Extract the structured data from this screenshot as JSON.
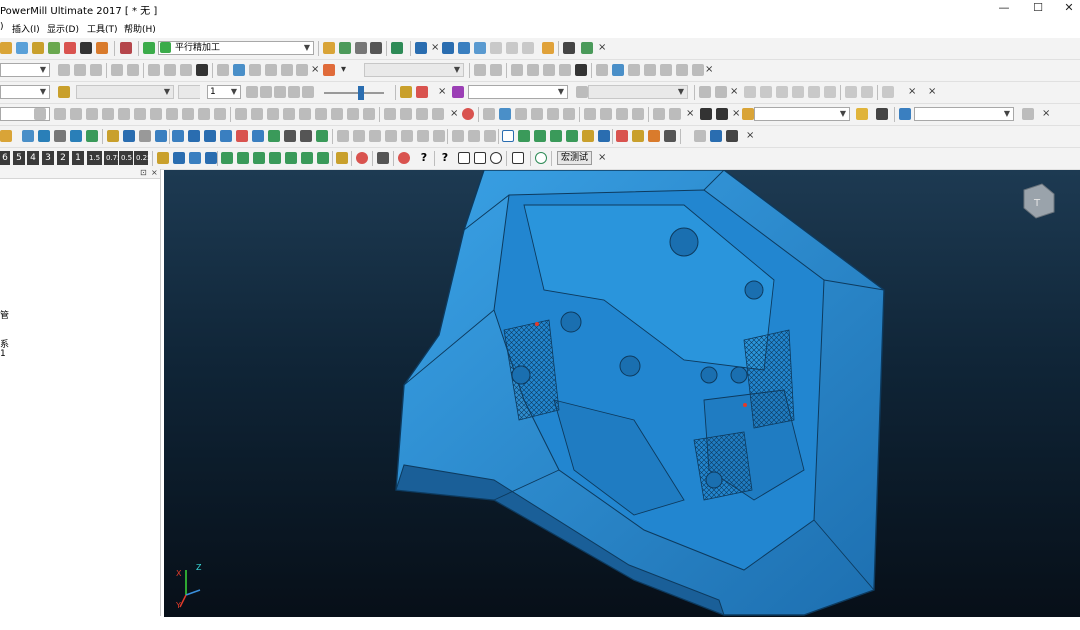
{
  "window": {
    "title": "PowerMill Ultimate 2017   [ * 无 ]",
    "minimize_glyph": "—",
    "maximize_glyph": "☐",
    "close_glyph": "✕"
  },
  "menu": {
    "items": [
      {
        "label": ")"
      },
      {
        "label": "插入(I)"
      },
      {
        "label": "显示(D)"
      },
      {
        "label": "工具(T)"
      },
      {
        "label": "帮助(H)"
      }
    ]
  },
  "toolbars": {
    "row1": {
      "strategy_select": "平行精加工"
    },
    "row4": {
      "step_value": "1"
    },
    "row7": {
      "level_buttons": [
        "6",
        "5",
        "4",
        "3",
        "2",
        "1",
        "1.5",
        "0.75",
        "0.5",
        "0.25"
      ],
      "macro_label": "宏测试"
    },
    "close_glyph": "×"
  },
  "tree": {
    "items": [
      {
        "label": "管"
      },
      {
        "label": "系"
      },
      {
        "label": "1"
      }
    ]
  },
  "viewport": {
    "model_color": "#2f8fd6",
    "cube_label": "T",
    "axis": {
      "x": "X",
      "y": "Y",
      "z": "Z"
    }
  },
  "colors": {
    "accent_blue": "#2f8fd6",
    "toolbar_bg": "#f3f3f3"
  }
}
